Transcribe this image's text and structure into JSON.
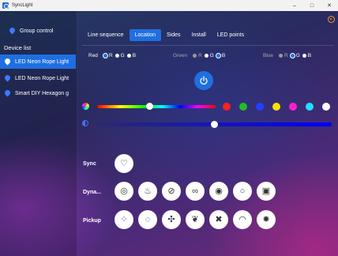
{
  "window": {
    "title": "SyncLight",
    "minimize": "–",
    "maximize": "□",
    "close": "✕"
  },
  "sidebar": {
    "group_control": "Group control",
    "device_list_header": "Device list",
    "devices": [
      {
        "label": "LED Neon Rope Light",
        "selected": true
      },
      {
        "label": "LED Neon Rope Light",
        "selected": false
      },
      {
        "label": "Smart DIY Hexagon g",
        "selected": false
      }
    ]
  },
  "tabs": [
    {
      "label": "Line sequence",
      "active": false
    },
    {
      "label": "Location",
      "active": true
    },
    {
      "label": "Sides",
      "active": false
    },
    {
      "label": "Install",
      "active": false
    },
    {
      "label": "LED points",
      "active": false
    }
  ],
  "channel_mapping": [
    {
      "label": "Red",
      "options": [
        "R",
        "G",
        "B"
      ],
      "selected": "R"
    },
    {
      "label": "Green",
      "options": [
        "R",
        "G",
        "B"
      ],
      "selected": "B"
    },
    {
      "label": "Blue",
      "options": [
        "R",
        "G",
        "B"
      ],
      "selected": "G"
    }
  ],
  "color": {
    "hue_position": 0.44,
    "swatches": [
      "#ff2020",
      "#20c020",
      "#2040ff",
      "#ffe000",
      "#ff20d0",
      "#20e0ff",
      "#ffffff"
    ]
  },
  "brightness": {
    "level": 0.5
  },
  "rows": {
    "sync_label": "Sync",
    "dynamic_label": "Dyna...",
    "pickup_label": "Pickup"
  },
  "icons": {
    "sync": [
      "heart-pulse-icon"
    ],
    "dynamic": [
      "gauge-icon",
      "flame-icon",
      "swirl-icon",
      "link-icon",
      "target-icon",
      "bubble-icon",
      "image-icon"
    ],
    "pickup": [
      "dots-circle-icon",
      "ring-icon",
      "sparkle-icon",
      "feather-icon",
      "cross-icon",
      "arc-icon",
      "burst-icon"
    ]
  }
}
